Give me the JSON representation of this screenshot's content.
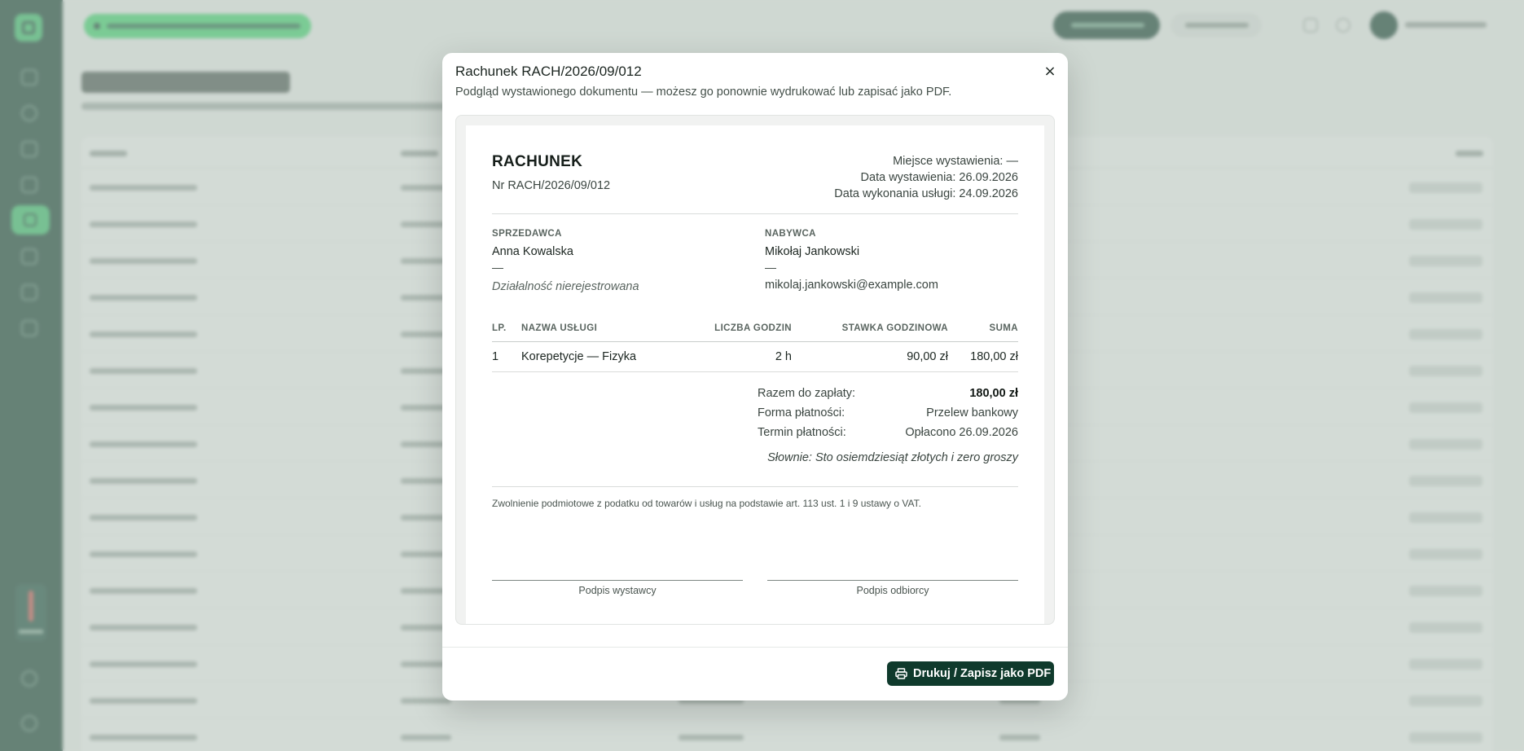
{
  "modal": {
    "title": "Rachunek RACH/2026/09/012",
    "description": "Podgląd wystawionego dokumentu — możesz go ponownie wydrukować lub zapisać jako PDF.",
    "close_label": "×",
    "print_button_label": "Drukuj / Zapisz jako PDF"
  },
  "document": {
    "heading": "RACHUNEK",
    "number": "Nr RACH/2026/09/012",
    "meta": {
      "place": "Miejsce wystawienia: —",
      "issue_date": "Data wystawienia: 26.09.2026",
      "service_date": "Data wykonania usługi: 24.09.2026"
    },
    "seller": {
      "label": "SPRZEDAWCA",
      "name": "Anna Kowalska",
      "address": "—",
      "note": "Działalność nierejestrowana"
    },
    "buyer": {
      "label": "NABYWCA",
      "name": "Mikołaj Jankowski",
      "address": "—",
      "email": "mikolaj.jankowski@example.com"
    },
    "table": {
      "headers": [
        "LP.",
        "NAZWA USŁUGI",
        "LICZBA GODZIN",
        "STAWKA GODZINOWA",
        "SUMA"
      ],
      "rows": [
        [
          "1",
          "Korepetycje — Fizyka",
          "2 h",
          "90,00 zł",
          "180,00 zł"
        ]
      ]
    },
    "summary": {
      "total_label": "Razem do zapłaty:",
      "total_value": "180,00 zł",
      "payment_label": "Forma płatności:",
      "payment_value": "Przelew bankowy",
      "due_label": "Termin płatności:",
      "due_value": "Opłacono 26.09.2026",
      "words": "Słownie: Sto osiemdziesiąt złotych i zero groszy"
    },
    "exemption": "Zwolnienie podmiotowe z podatku od towarów i usług na podstawie art. 113 ust. 1 i 9 ustawy o VAT.",
    "signature_issuer": "Podpis wystawcy",
    "signature_receiver": "Podpis odbiorcy"
  },
  "colors": {
    "sidebar": "#0f3a2c",
    "accent": "#35c46a",
    "primary_button": "#0f3a2c"
  },
  "icons": {
    "close": "close-icon",
    "print": "printer-icon"
  }
}
